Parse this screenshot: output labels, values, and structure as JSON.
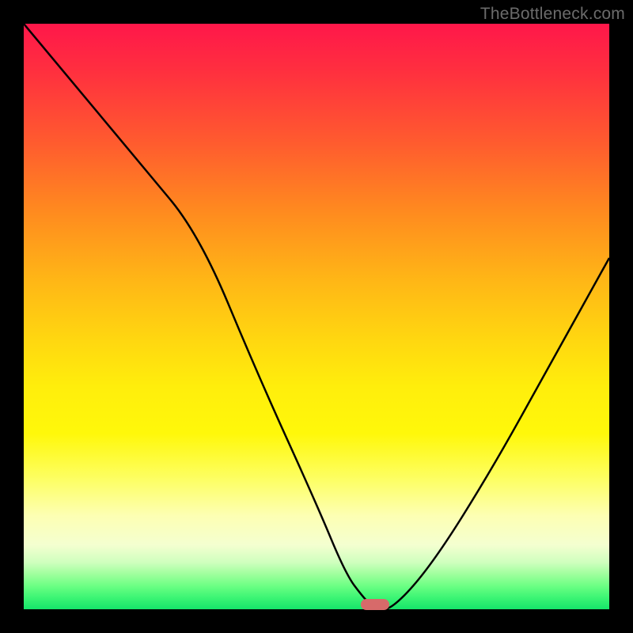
{
  "watermark": "TheBottleneck.com",
  "chart_data": {
    "type": "line",
    "title": "",
    "xlabel": "",
    "ylabel": "",
    "xlim": [
      0,
      100
    ],
    "ylim": [
      0,
      100
    ],
    "x": [
      0,
      10,
      20,
      30,
      40,
      50,
      55,
      58,
      60,
      63,
      70,
      80,
      90,
      100
    ],
    "values": [
      100,
      88,
      76,
      64,
      40,
      18,
      6,
      2,
      0,
      0,
      8,
      24,
      42,
      60
    ],
    "marker": {
      "x": 60,
      "y": 0
    },
    "annotations": []
  },
  "marker_color": "#d76a6a"
}
